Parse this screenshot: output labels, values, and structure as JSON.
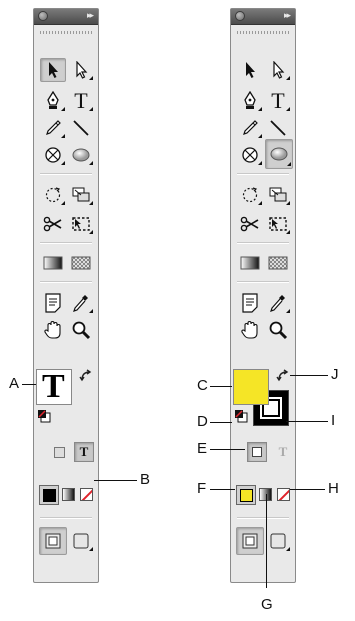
{
  "callouts": {
    "a": "A",
    "b": "B",
    "c": "C",
    "d": "D",
    "e": "E",
    "f": "F",
    "g": "G",
    "h": "H",
    "i": "I",
    "j": "J"
  },
  "type_tool_glyph": "T",
  "swatches": {
    "fill_yellow": "#f5e526",
    "stroke_black": "#000000",
    "none_red": "#e0242c"
  },
  "icons": [
    "selection-tool-icon",
    "direct-selection-tool-icon",
    "pen-tool-icon",
    "type-tool-icon",
    "pencil-tool-icon",
    "line-tool-icon",
    "rectangle-frame-tool-icon",
    "ellipse-tool-icon",
    "rotate-tool-icon",
    "free-transform-tool-icon",
    "scissors-tool-icon",
    "gradient-feather-icon",
    "gradient-tool-icon",
    "gradient-swatch-icon",
    "note-tool-icon",
    "eyedropper-tool-icon",
    "hand-tool-icon",
    "zoom-tool-icon",
    "swap-arrow-icon",
    "default-fill-stroke-icon",
    "formatting-container-icon",
    "formatting-text-icon",
    "apply-color-icon",
    "apply-gradient-icon",
    "apply-none-icon",
    "normal-view-icon",
    "screen-mode-icon"
  ]
}
